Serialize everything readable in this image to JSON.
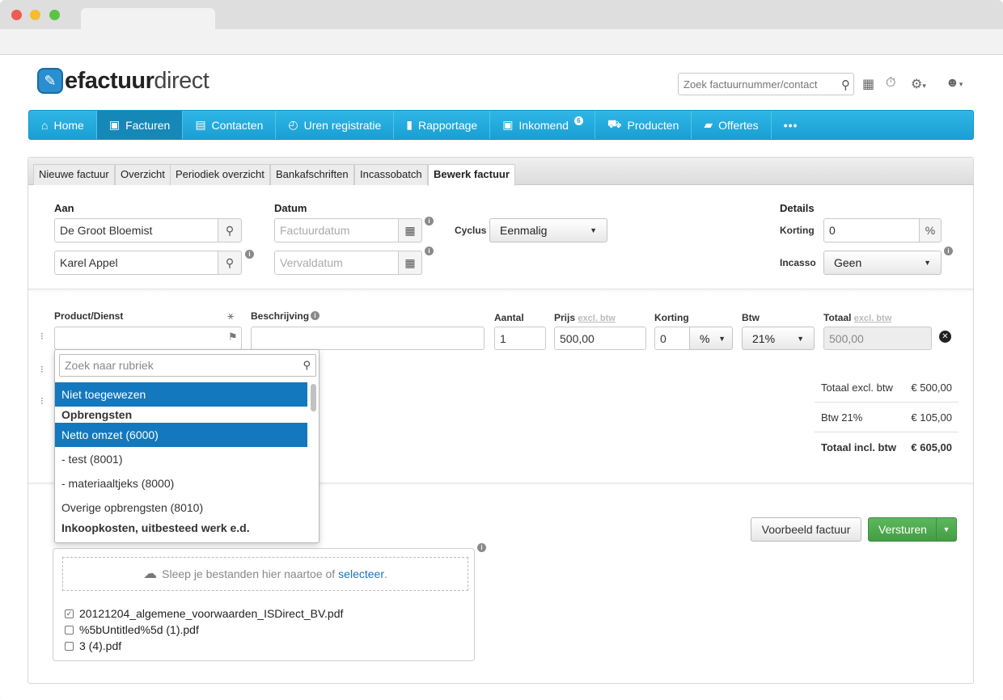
{
  "app": {
    "logo_bold": "efactuur",
    "logo_light": "direct",
    "search_placeholder": "Zoek factuurnummer/contact"
  },
  "nav": {
    "items": [
      {
        "label": "Home",
        "icon": "home-icon"
      },
      {
        "label": "Facturen",
        "icon": "invoice-icon",
        "active": true
      },
      {
        "label": "Contacten",
        "icon": "contacts-icon"
      },
      {
        "label": "Uren registratie",
        "icon": "clock-icon"
      },
      {
        "label": "Rapportage",
        "icon": "bar-chart-icon"
      },
      {
        "label": "Inkomend",
        "icon": "inbox-icon",
        "badge": "6"
      },
      {
        "label": "Producten",
        "icon": "cart-icon"
      },
      {
        "label": "Offertes",
        "icon": "folder-icon"
      },
      {
        "label": "•••",
        "icon": "more-icon"
      }
    ],
    "accent": "#1a9fd4"
  },
  "subtabs": [
    "Nieuwe factuur",
    "Overzicht",
    "Periodiek overzicht",
    "Bankafschriften",
    "Incassobatch",
    "Bewerk factuur"
  ],
  "form": {
    "aan_label": "Aan",
    "aan_value": "De Groot Bloemist",
    "contact_value": "Karel Appel",
    "datum_label": "Datum",
    "factuurdatum_placeholder": "Factuurdatum",
    "vervaldatum_placeholder": "Vervaldatum",
    "cyclus_label": "Cyclus",
    "cyclus_value": "Eenmalig",
    "details_label": "Details",
    "korting_label": "Korting",
    "korting_value": "0",
    "korting_unit": "%",
    "incasso_label": "Incasso",
    "incasso_value": "Geen"
  },
  "line": {
    "product_label": "Product/Dienst",
    "beschrijving_label": "Beschrijving",
    "aantal_label": "Aantal",
    "aantal_value": "1",
    "prijs_label": "Prijs",
    "excl_btw": "excl. btw",
    "prijs_value": "500,00",
    "korting_label": "Korting",
    "korting_value": "0",
    "korting_unit": "%",
    "btw_label": "Btw",
    "btw_value": "21%",
    "totaal_label": "Totaal",
    "totaal_value": "500,00"
  },
  "dropdown": {
    "search_placeholder": "Zoek naar rubriek",
    "options": [
      {
        "label": "Niet toegewezen"
      },
      {
        "label": "Opbrengsten"
      },
      {
        "label": "Netto omzet (6000)"
      },
      {
        "label": "- test (8001)"
      },
      {
        "label": "- materiaaltjeks (8000)"
      },
      {
        "label": "Overige opbrengsten (8010)"
      },
      {
        "label": "Inkoopkosten, uitbesteed werk e.d."
      }
    ]
  },
  "totals": [
    {
      "label": "Totaal excl. btw",
      "value": "€ 500,00"
    },
    {
      "label": "Btw 21%",
      "value": "€ 105,00"
    },
    {
      "label": "Totaal incl. btw",
      "value": "€ 605,00"
    }
  ],
  "actions": {
    "preview": "Voorbeeld factuur",
    "send": "Versturen"
  },
  "upload": {
    "drop_text": "Sleep je bestanden hier naartoe of",
    "select_link": "selecteer",
    "select_suffix": ".",
    "files": [
      {
        "name": "20121204_algemene_voorwaarden_ISDirect_BV.pdf",
        "checked": true
      },
      {
        "name": "%5bUntitled%5d (1).pdf",
        "checked": false
      },
      {
        "name": "3 (4).pdf",
        "checked": false
      }
    ]
  }
}
